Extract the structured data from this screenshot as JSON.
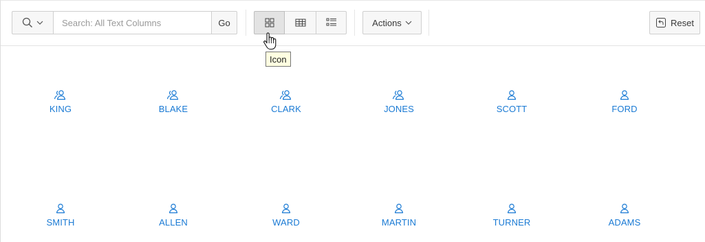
{
  "search": {
    "placeholder": "Search: All Text Columns",
    "go_label": "Go",
    "column_picker_icon": "search-icon"
  },
  "views": {
    "icon_view_icon": "grid-icon",
    "report_view_icon": "table-icon",
    "detail_view_icon": "list-icon",
    "selected": "icon"
  },
  "actions": {
    "label": "Actions"
  },
  "reset": {
    "label": "Reset"
  },
  "tooltip": {
    "text": "Icon"
  },
  "accent_color": "#1a7ad4",
  "employees": [
    {
      "name": "KING",
      "icon": "users-icon"
    },
    {
      "name": "BLAKE",
      "icon": "users-icon"
    },
    {
      "name": "CLARK",
      "icon": "users-icon"
    },
    {
      "name": "JONES",
      "icon": "users-icon"
    },
    {
      "name": "SCOTT",
      "icon": "user-icon"
    },
    {
      "name": "FORD",
      "icon": "user-icon"
    },
    {
      "name": "SMITH",
      "icon": "user-icon"
    },
    {
      "name": "ALLEN",
      "icon": "user-icon"
    },
    {
      "name": "WARD",
      "icon": "user-icon"
    },
    {
      "name": "MARTIN",
      "icon": "user-icon"
    },
    {
      "name": "TURNER",
      "icon": "user-icon"
    },
    {
      "name": "ADAMS",
      "icon": "user-icon"
    }
  ]
}
